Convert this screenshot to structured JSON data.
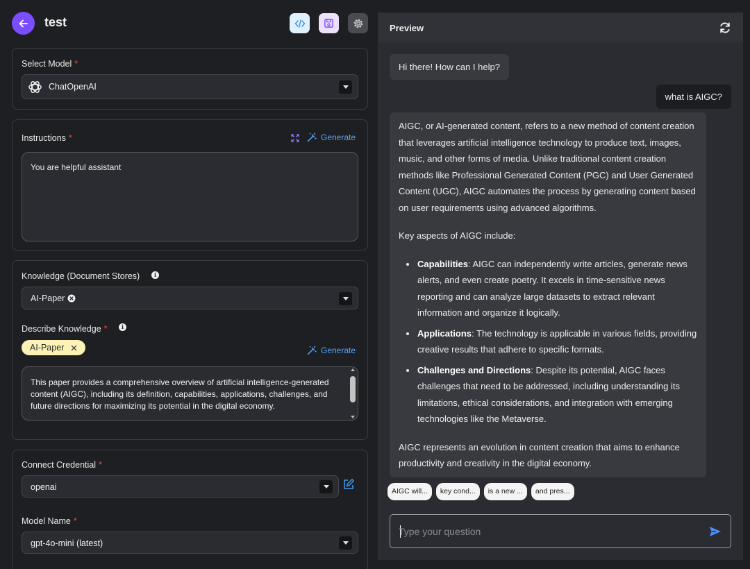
{
  "header": {
    "title": "test"
  },
  "model": {
    "label": "Select Model",
    "required_mark": "*",
    "value": "ChatOpenAI"
  },
  "instructions": {
    "label": "Instructions",
    "required_mark": "*",
    "generate_label": "Generate",
    "value": "You are helpful assistant"
  },
  "knowledge": {
    "label": "Knowledge (Document Stores)",
    "selected_chip": "AI-Paper",
    "describe_label": "Describe Knowledge",
    "required_mark": "*",
    "tag": "AI-Paper",
    "generate_label": "Generate",
    "description": "This paper provides a comprehensive overview of artificial intelligence-generated content (AIGC), including its definition, capabilities, applications, challenges, and future directions for maximizing its potential in the digital economy."
  },
  "credential": {
    "label": "Connect Credential",
    "required_mark": "*",
    "value": "openai",
    "model_name_label": "Model Name",
    "model_name_required": "*",
    "model_name_value": "gpt-4o-mini (latest)"
  },
  "preview": {
    "title": "Preview",
    "greeting": "Hi there! How can I help?",
    "user_message": "what is AIGC?",
    "answer": {
      "intro": "AIGC, or AI-generated content, refers to a new method of content creation that leverages artificial intelligence technology to produce text, images, music, and other forms of media. Unlike traditional content creation methods like Professional Generated Content (PGC) and User Generated Content (UGC), AIGC automates the process by generating content based on user requirements using advanced algorithms.",
      "aspects_heading": "Key aspects of AIGC include:",
      "aspects": [
        {
          "title": "Capabilities",
          "text": ": AIGC can independently write articles, generate news alerts, and even create poetry. It excels in time-sensitive news reporting and can analyze large datasets to extract relevant information and organize it logically."
        },
        {
          "title": "Applications",
          "text": ": The technology is applicable in various fields, providing creative results that adhere to specific formats."
        },
        {
          "title": "Challenges and Directions",
          "text": ": Despite its potential, AIGC faces challenges that need to be addressed, including understanding its limitations, ethical considerations, and integration with emerging technologies like the Metaverse."
        }
      ],
      "conclusion": "AIGC represents an evolution in content creation that aims to enhance productivity and creativity in the digital economy."
    },
    "suggestions": [
      "AIGC will...",
      "key cond...",
      "is a new ...",
      "and pres..."
    ],
    "input_placeholder": "Type your question"
  },
  "colors": {
    "accent": "#7c4dff",
    "link": "#5aa7ff",
    "tag_bg": "#fdf2b5",
    "required": "#f0483e"
  },
  "icons": [
    "back-arrow-icon",
    "code-icon",
    "save-icon",
    "gear-icon",
    "openai-logo-icon",
    "expand-icon",
    "magic-wand-icon",
    "info-icon",
    "close-icon",
    "edit-icon",
    "refresh-icon",
    "send-icon",
    "dropdown-arrow-icon"
  ]
}
